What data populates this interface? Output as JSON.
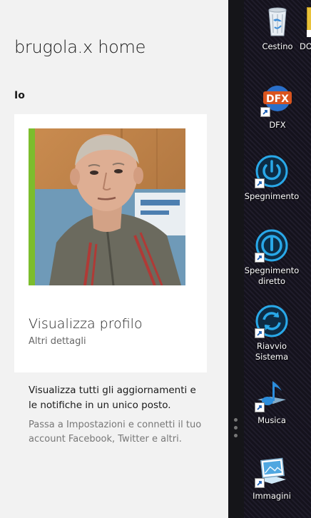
{
  "app": {
    "title": "brugola.x home",
    "section": "Io"
  },
  "profile_card": {
    "title": "Visualizza profilo",
    "subtitle": "Altri dettagli",
    "accent_color": "#7cbd2d"
  },
  "info": {
    "main": "Visualizza tutti gli aggiornamenti e le notifiche in un unico posto.",
    "hint": "Passa a Impostazioni e connetti il tuo account Facebook, Twitter e altri."
  },
  "desktop_icons": [
    {
      "label": "Cestino",
      "icon": "recycle-bin-icon",
      "shortcut": false
    },
    {
      "label": "DFX",
      "icon": "dfx-icon",
      "shortcut": true
    },
    {
      "label": "Spegnimento",
      "icon": "power-icon",
      "shortcut": true
    },
    {
      "label": "Spegnimento diretto",
      "icon": "power-direct-icon",
      "shortcut": true
    },
    {
      "label": "Riavvio Sistema",
      "icon": "restart-icon",
      "shortcut": true
    },
    {
      "label": "Musica",
      "icon": "music-note-icon",
      "shortcut": true
    },
    {
      "label": "Immagini",
      "icon": "pictures-icon",
      "shortcut": true
    }
  ],
  "partial_icon": {
    "label": "DO"
  }
}
